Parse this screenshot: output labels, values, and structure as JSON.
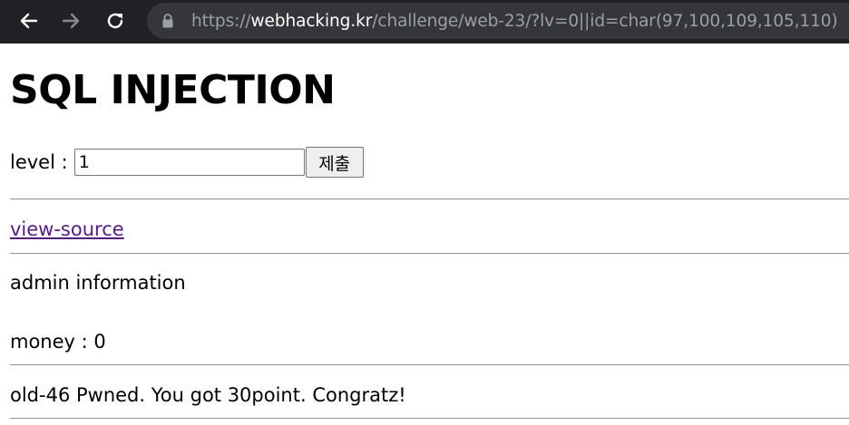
{
  "browser": {
    "url_scheme": "https://",
    "url_host": "webhacking.kr",
    "url_path": "/challenge/web-23/?lv=0||id=char(97,100,109,105,110)"
  },
  "page": {
    "title": "SQL INJECTION",
    "level_label": "level :",
    "level_value": "1",
    "submit_label": "제출",
    "view_source_link": "view-source",
    "admin_info": "admin information",
    "money_line": "money : 0",
    "result_message": "old-46 Pwned. You got 30point. Congratz!"
  }
}
